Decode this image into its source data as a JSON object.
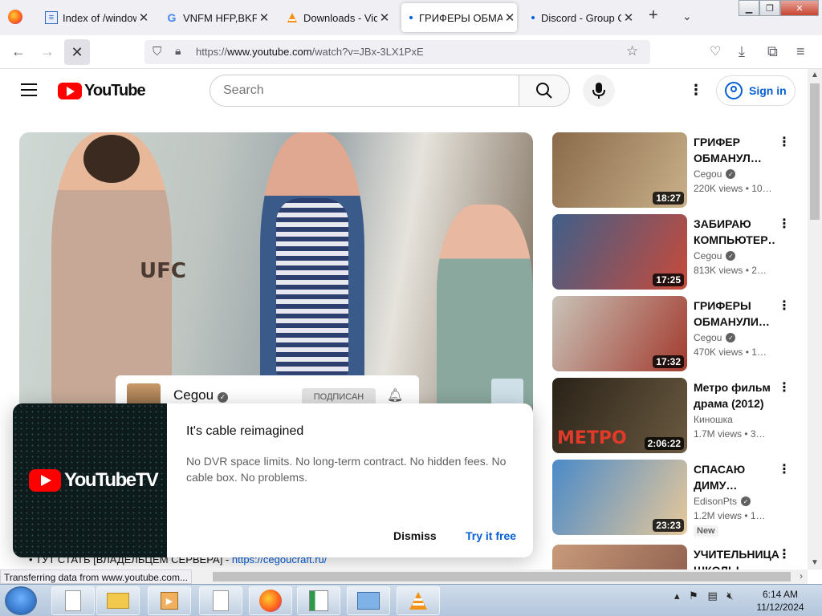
{
  "browser": {
    "tabs": [
      {
        "label": "Index of /window",
        "icon": "document-icon"
      },
      {
        "label": "VNFM HFP,BKF ,В",
        "icon": "google-icon"
      },
      {
        "label": "Downloads - Vide",
        "icon": "vlc-icon"
      },
      {
        "label": "ГРИФЕРЫ ОБМА",
        "icon": "youtube-icon",
        "active": true
      },
      {
        "label": "Discord - Group C",
        "icon": "discord-icon"
      }
    ],
    "url_prefix": "https://",
    "url_host": "www.youtube.com",
    "url_path": "/watch?v=JBx-3LX1PxE",
    "status": "Transferring data from www.youtube.com..."
  },
  "youtube": {
    "logo_text": "YouTube",
    "search_placeholder": "Search",
    "sign_in": "Sign in"
  },
  "player": {
    "channel_name": "Cegou",
    "subscribed_label": "ПОДПИСАН",
    "shirt_text": "UFC"
  },
  "description_line": {
    "text": "• ТУТ СТАТЬ [ВЛАДЕЛЬЦЕМ СЕРВЕРА] - ",
    "link": "https://cegoucraft.ru/"
  },
  "promo": {
    "logo_text": "YouTubeTV",
    "title": "It's cable reimagined",
    "body": "No DVR space limits. No long-term contract. No hidden fees. No cable box. No problems.",
    "dismiss": "Dismiss",
    "try": "Try it free"
  },
  "recommendations": [
    {
      "title": "ГРИФЕР ОБМАНУЛ…",
      "channel": "Cegou",
      "verified": true,
      "meta": "220K views  • 10…",
      "duration": "18:27",
      "color1": "#8a6a4a",
      "color2": "#c9b08a"
    },
    {
      "title": "ЗАБИРАЮ КОМПЬЮТЕР…",
      "channel": "Cegou",
      "verified": true,
      "meta": "813K views  • 2…",
      "duration": "17:25",
      "color1": "#3f5f8a",
      "color2": "#c84a3a"
    },
    {
      "title": "ГРИФЕРЫ ОБМАНУЛИ…",
      "channel": "Cegou",
      "verified": true,
      "meta": "470K views  • 1…",
      "duration": "17:32",
      "color1": "#c9c3b8",
      "color2": "#a33a2e"
    },
    {
      "title": "Метро фильм драма (2012)",
      "channel": "Киношка",
      "verified": false,
      "meta": "1.7M views  • 3…",
      "duration": "2:06:22",
      "thumb_text": "МЕТРО",
      "color1": "#2a2218",
      "color2": "#6a5a40"
    },
    {
      "title": "СПАСАЮ ДИМУ…",
      "channel": "EdisonPts",
      "verified": true,
      "meta": "1.2M views  • 1…",
      "duration": "23:23",
      "badge": "New",
      "color1": "#4a8ac8",
      "color2": "#e8c89a"
    },
    {
      "title": "УЧИТЕЛЬНИЦА ШКОЛЫ…",
      "channel": "",
      "verified": false,
      "meta": "",
      "duration": "",
      "color1": "#c89a7a",
      "color2": "#8a5a4a"
    }
  ],
  "taskbar": {
    "clock_time": "6:14 AM",
    "clock_date": "11/12/2024"
  },
  "colors": {
    "youtube_red": "#ff0000",
    "link_blue": "#065fd4"
  }
}
